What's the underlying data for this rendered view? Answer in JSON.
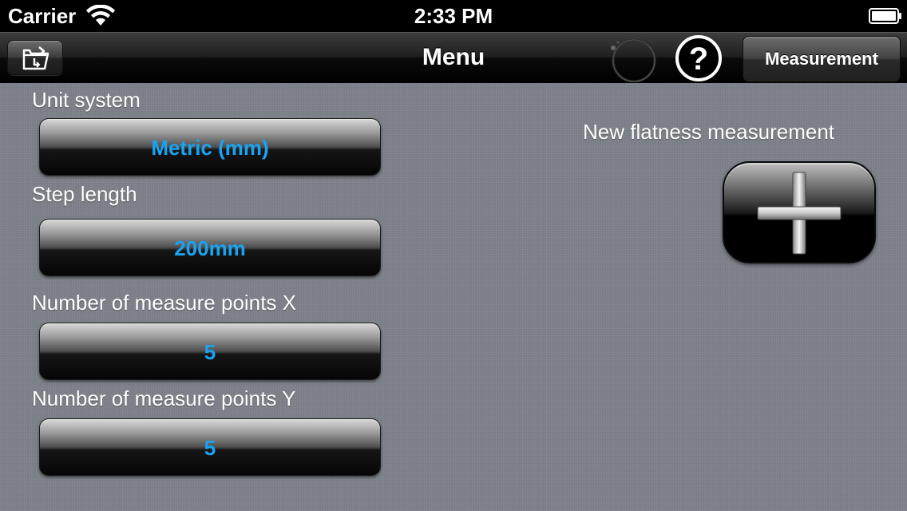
{
  "status_bar": {
    "carrier": "Carrier",
    "time": "2:33 PM"
  },
  "nav_bar": {
    "title": "Menu",
    "measurement_button": "Measurement",
    "icons": [
      "folder-icon",
      "spinner-icon",
      "help-icon"
    ]
  },
  "settings": [
    {
      "label": "Unit system",
      "value": "Metric (mm)"
    },
    {
      "label": "Step length",
      "value": "200mm"
    },
    {
      "label": "Number of measure points X",
      "value": "5"
    },
    {
      "label": "Number of measure points Y",
      "value": "5"
    }
  ],
  "new_measurement": {
    "label": "New flatness measurement",
    "icon": "plus-icon"
  },
  "colors": {
    "value_text": "#19a3f2",
    "background": "#7b7f87",
    "nav_bar": "#1f1f1f"
  }
}
